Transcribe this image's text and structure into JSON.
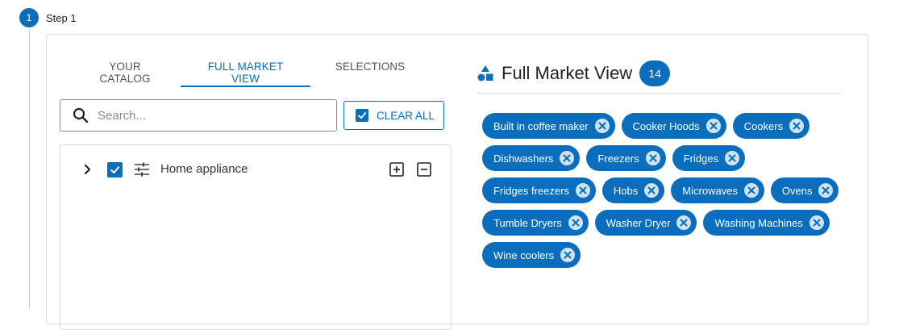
{
  "step": {
    "number": "1",
    "label": "Step 1"
  },
  "tabs": [
    {
      "label": "YOUR CATALOG"
    },
    {
      "label": "FULL MARKET VIEW"
    },
    {
      "label": "SELECTIONS"
    }
  ],
  "active_tab": "FULL MARKET VIEW",
  "search": {
    "placeholder": "Search...",
    "value": ""
  },
  "clear_all": {
    "label": "CLEAR ALL"
  },
  "tree": {
    "items": [
      {
        "label": "Home appliance",
        "checked": true,
        "expanded": false
      }
    ]
  },
  "panel": {
    "title": "Full Market View",
    "count": "14"
  },
  "chips": [
    [
      "Built in coffee maker",
      "Cooker Hoods",
      "Cookers"
    ],
    [
      "Dishwashers",
      "Freezers",
      "Fridges"
    ],
    [
      "Fridges freezers",
      "Hobs",
      "Microwaves",
      "Ovens"
    ],
    [
      "Tumble Dryers",
      "Washer Dryer",
      "Washing Machines"
    ],
    [
      "Wine coolers"
    ]
  ],
  "colors": {
    "accent": "#0a6ebd",
    "chip_close_bg": "#cfe3f5",
    "border": "#dcdcdc"
  },
  "icons": {
    "search": "search-icon",
    "checkbox": "checkbox-checked-icon",
    "expand": "chevron-right-icon",
    "filter": "sliders-icon",
    "add": "plus-square-icon",
    "remove": "minus-square-icon",
    "title": "shapes-icon",
    "chip_remove": "close-icon"
  }
}
